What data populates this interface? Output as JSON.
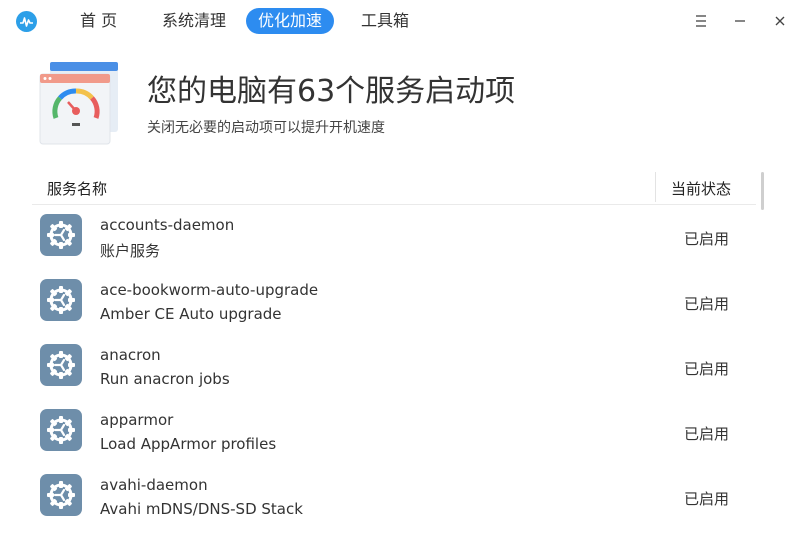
{
  "titlebar": {
    "tabs": [
      {
        "label": "首 页",
        "active": false
      },
      {
        "label": "系统清理",
        "active": false
      },
      {
        "label": "优化加速",
        "active": true
      },
      {
        "label": "工具箱",
        "active": false
      }
    ],
    "icons": {
      "menu": "menu-icon",
      "minimize": "minimize-icon",
      "close": "close-icon"
    }
  },
  "header": {
    "title": "您的电脑有63个服务启动项",
    "subtitle": "关闭无必要的启动项可以提升开机速度",
    "icon": "speedometer-icon"
  },
  "table": {
    "columns": {
      "name": "服务名称",
      "status": "当前状态"
    },
    "rows": [
      {
        "name": "accounts-daemon",
        "description": "账户服务",
        "status": "已启用"
      },
      {
        "name": "ace-bookworm-auto-upgrade",
        "description": "Amber CE Auto upgrade",
        "status": "已启用"
      },
      {
        "name": "anacron",
        "description": "Run anacron jobs",
        "status": "已启用"
      },
      {
        "name": "apparmor",
        "description": "Load AppArmor profiles",
        "status": "已启用"
      },
      {
        "name": "avahi-daemon",
        "description": "Avahi mDNS/DNS-SD Stack",
        "status": "已启用"
      }
    ]
  },
  "colors": {
    "accent": "#2d8cf0",
    "gear_tile": "#6e8eaa"
  }
}
